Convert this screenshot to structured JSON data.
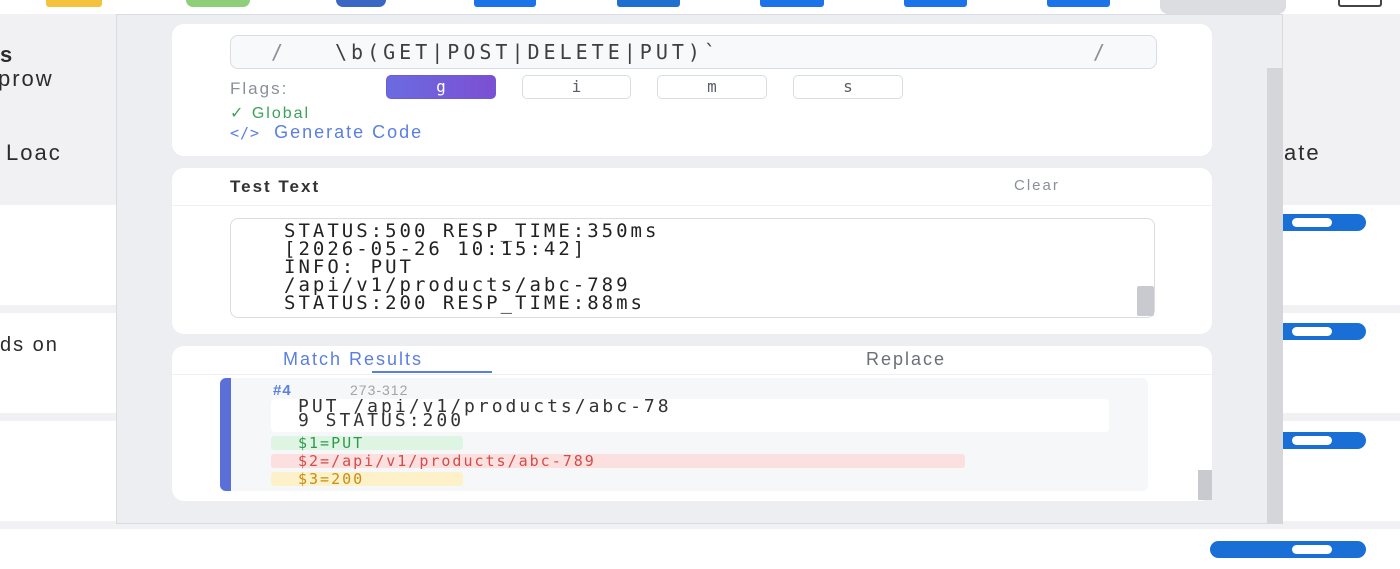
{
  "background": {
    "fragments": [
      "s",
      "prow",
      "Loac",
      "ate",
      "ds on"
    ],
    "extension_icons": [
      {
        "name": "ext-yellow",
        "color": "#f4c23d"
      },
      {
        "name": "ext-green",
        "color": "#8fcf7a"
      },
      {
        "name": "ext-globe",
        "color": "#3b67c4"
      },
      {
        "name": "ext-blue-1",
        "color": "#1a73e8"
      },
      {
        "name": "ext-blue-2",
        "color": "#1f6fd1"
      },
      {
        "name": "ext-blue-3",
        "color": "#1a73e8"
      },
      {
        "name": "ext-blue-4",
        "color": "#1a73e8"
      },
      {
        "name": "ext-blue-5",
        "color": "#1a6fd6"
      }
    ]
  },
  "popup": {
    "pattern": {
      "open_delim": "/",
      "value": "\\b(GET|POST|DELETE|PUT)`",
      "close_delim": "/"
    },
    "flags": {
      "label": "Flags:",
      "items": [
        {
          "label": "g",
          "active": true
        },
        {
          "label": "i",
          "active": false
        },
        {
          "label": "m",
          "active": false
        },
        {
          "label": "s",
          "active": false
        }
      ],
      "description": "✓ Global"
    },
    "generate_code": {
      "icon": "</>",
      "label": "Generate Code"
    },
    "test_text": {
      "title": "Test Text",
      "clear_label": "Clear",
      "lines": [
        "STATUS:500 RESP_TIME:350ms",
        "[2026-05-26 10:15:42]",
        "INFO: PUT",
        "/api/v1/products/abc-789",
        "STATUS:200 RESP_TIME:88ms"
      ]
    },
    "tabs": {
      "match_results": "Match Results",
      "replace": "Replace"
    },
    "match": {
      "number": "#4",
      "range": "273-312",
      "text_line1": "PUT /api/v1/products/abc-78",
      "text_line2": "9 STATUS:200",
      "groups": [
        "$1=PUT",
        "$2=/api/v1/products/abc-789",
        "$3=200"
      ]
    }
  },
  "colors": {
    "accent": "#5b7fe0",
    "flag_active": "#6b6be0",
    "success": "#3aa35a",
    "toggle": "#1a6fd6"
  }
}
